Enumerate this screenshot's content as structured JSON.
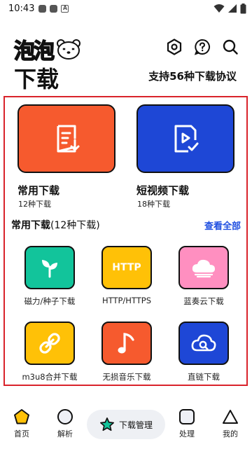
{
  "status": {
    "time": "10:43",
    "a_label": "A"
  },
  "header": {
    "logo_text": "泡泡",
    "title": "下载",
    "protocol_text": "支持56种下载协议"
  },
  "featured": [
    {
      "title": "常用下载",
      "subtitle": "12种下载",
      "color": "#f65a2e"
    },
    {
      "title": "短视频下载",
      "subtitle": "18种下载",
      "color": "#1e47d6"
    }
  ],
  "section": {
    "title_bold": "常用下载",
    "title_rest": "(12种下载)",
    "see_all": "查看全部"
  },
  "tiles": [
    {
      "label": "磁力/种子下载",
      "icon": "sprout-icon",
      "color": "#12c49b"
    },
    {
      "label": "HTTP/HTTPS",
      "icon": "http-text-icon",
      "icon_text": "HTTP",
      "color": "#ffc107"
    },
    {
      "label": "蓝奏云下载",
      "icon": "cloud-icon",
      "color": "#ff8fc0"
    },
    {
      "label": "m3u8合并下载",
      "icon": "link-icon",
      "color": "#ffc107"
    },
    {
      "label": "无损音乐下载",
      "icon": "music-note-icon",
      "color": "#f65a2e"
    },
    {
      "label": "直链下载",
      "icon": "cloud-search-icon",
      "color": "#1e47d6"
    }
  ],
  "nav": {
    "home": "首页",
    "parse": "解析",
    "download_manager": "下载管理",
    "process": "处理",
    "mine": "我的"
  }
}
